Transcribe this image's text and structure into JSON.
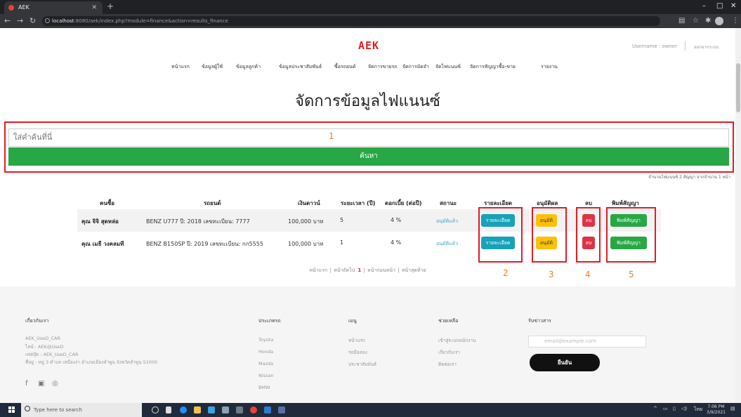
{
  "browser": {
    "tab_title": "AEK",
    "url_host": "localhost",
    "url_rest": ":8080/aek/index.php?module=finance&action=results_finance"
  },
  "site": {
    "logo": "AEK",
    "username": "Username : owner",
    "logout": "ออกจากระบบ",
    "menu": [
      "หน้าแรก",
      "ข้อมูลผู้ใช้",
      "ข้อมูลลูกค้า",
      "ข้อมูลประชาสัมพันธ์",
      "ซื้อรถยนต์",
      "จัดการขายรถ",
      "จัดการมัดจำ",
      "จัดไฟแนนซ์",
      "จัดการสัญญาซื้อ-ขาย",
      "รายงาน"
    ]
  },
  "main": {
    "title": "จัดการข้อมูลไฟแนนซ์",
    "search_placeholder": "ใส่คำค้นที่นี่",
    "search_button": "ค้นหา",
    "count_text": "จำนวนไฟแนนซ์ 2 สัญญา จากจำนวน 1 หน้า"
  },
  "annotations": [
    "1",
    "2",
    "3",
    "4",
    "5"
  ],
  "table": {
    "headers": [
      "คนซื้อ",
      "รถยนต์",
      "เงินดาวน์",
      "ระยะเวลา (ปี)",
      "ดอกเบี้ย (ต่อปี)",
      "สถานะ",
      "รายละเอียด",
      "อนุมัติผล",
      "ลบ",
      "พิมพ์สัญญา"
    ],
    "rows": [
      {
        "buyer": "คุณ จิจิ สุดหล่อ",
        "car": "BENZ U777 ปี: 2018 เลขทะเบียน: 7777",
        "down": "100,000 บาท",
        "years": "5",
        "interest": "4 %",
        "status": "อนุมัติแล้ว"
      },
      {
        "buyer": "คุณ เมธี วงคลมที",
        "car": "BENZ B150SP ปี: 2019 เลขทะเบียน: กก5555",
        "down": "100,000 บาท",
        "years": "1",
        "interest": "4 %",
        "status": "อนุมัติแล้ว"
      }
    ],
    "btn_detail": "รายละเอียด",
    "btn_approve": "อนุมัติ",
    "btn_delete": "ลบ",
    "btn_print": "พิมพ์สัญญา"
  },
  "pager": {
    "first": "หน้าแรก",
    "next": "หน้าถัดไป",
    "current": "1",
    "prev": "หน้าก่อนหน้า",
    "last": "หน้าสุดท้าย"
  },
  "footer": {
    "about_title": "เกี่ยวกับเรา",
    "about_lines": [
      "AEK_UseD_CAR",
      "ไลน์ : AEK@UseD",
      "เฟสบุ๊ค : AEK_UseD_CAR",
      "ที่อยู่ : หมู่ 3 ตำบล เหมืองง่า อำเภอเมืองลำพูน จังหวัดลำพูน 51000"
    ],
    "types_title": "ประเภทรถ",
    "types": [
      "Toyota",
      "Honda",
      "Mazda",
      "Nissan",
      "BMW"
    ],
    "menu_title": "เมนู",
    "menu_items": [
      "หน้าแรก",
      "รถมือสอง",
      "ประชาสัมพันธ์"
    ],
    "help_title": "ช่วยเหลือ",
    "help_items": [
      "เข้าสู่ระบบพนักงาน",
      "เกี่ยวกับเรา",
      "ติดต่อเรา"
    ],
    "news_title": "รับข่าวสาร",
    "email_placeholder": "email@example.com",
    "subscribe": "ยืนยัน"
  },
  "taskbar": {
    "search": "Type here to search",
    "time": "7:06 PM",
    "date": "3/9/2021",
    "lang": "ไทย"
  }
}
